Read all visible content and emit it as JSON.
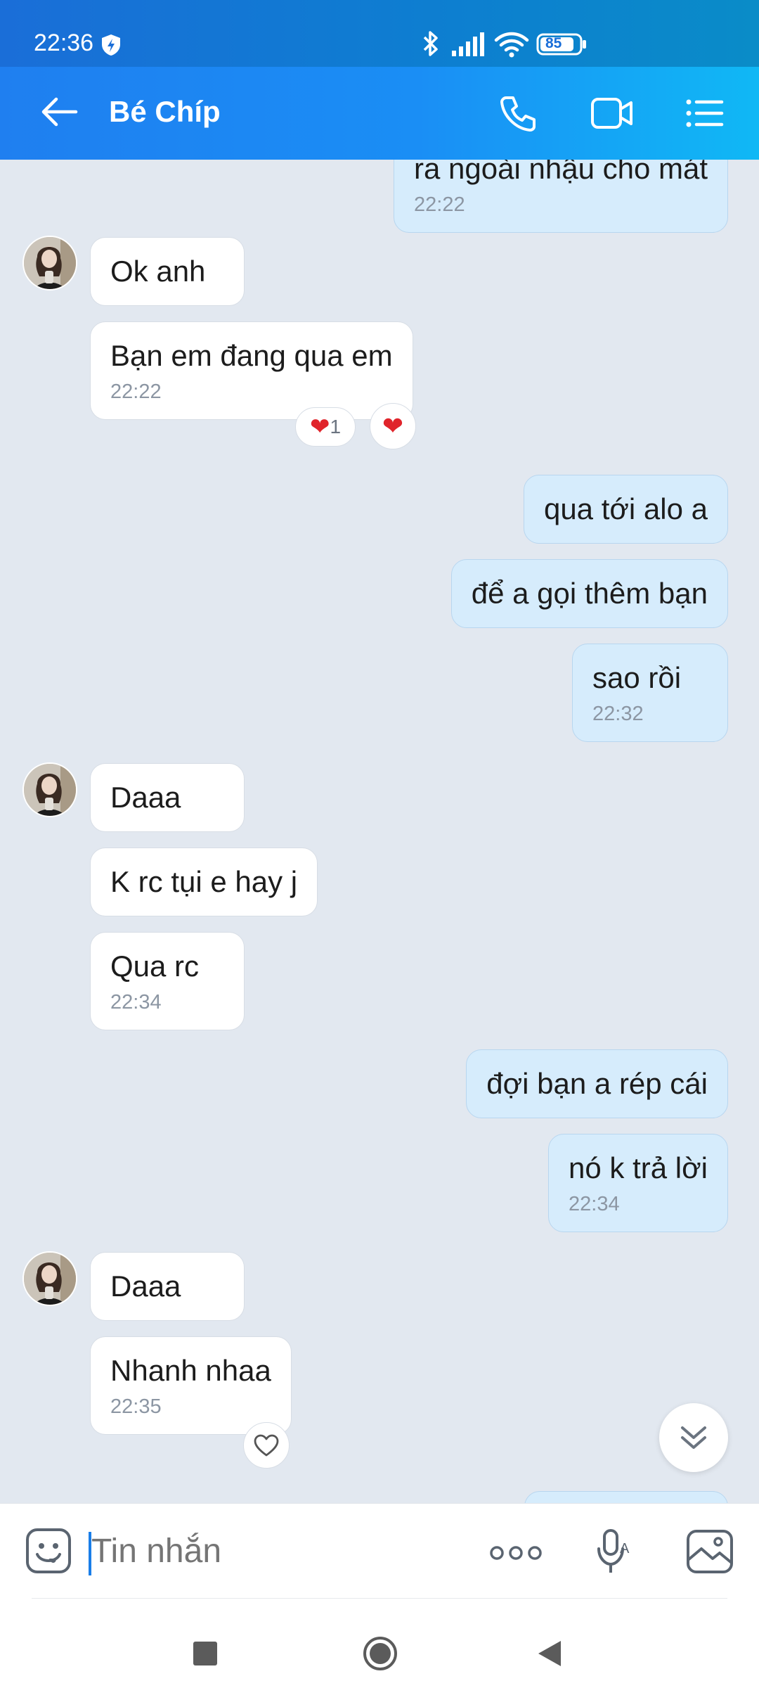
{
  "status_bar": {
    "time": "22:36",
    "battery": "85",
    "icons": [
      "shield-check-icon",
      "bluetooth-icon",
      "signal-icon",
      "wifi-icon",
      "battery-icon"
    ]
  },
  "header": {
    "title": "Bé Chíp",
    "actions": [
      "back-arrow-icon",
      "phone-icon",
      "video-call-icon",
      "list-menu-icon"
    ]
  },
  "messages": [
    {
      "dir": "out",
      "text": "ra ngoài nhậu cho mát",
      "time": "22:22"
    },
    {
      "dir": "in",
      "text": "Ok anh",
      "avatar": true
    },
    {
      "dir": "in",
      "text": "Bạn em đang qua em",
      "time": "22:22",
      "reaction": "❤",
      "reaction_count": "1"
    },
    {
      "dir": "out",
      "text": "qua tới alo a"
    },
    {
      "dir": "out",
      "text": "để a gọi thêm bạn"
    },
    {
      "dir": "out",
      "text": "sao rồi",
      "time": "22:32"
    },
    {
      "dir": "in",
      "text": "Daaa",
      "avatar": true
    },
    {
      "dir": "in",
      "text": "K rc tụi e hay j"
    },
    {
      "dir": "in",
      "text": "Qua rc",
      "time": "22:34"
    },
    {
      "dir": "out",
      "text": "đợi bạn a rép cái"
    },
    {
      "dir": "out",
      "text": "nó k trả lời",
      "time": "22:34"
    },
    {
      "dir": "in",
      "text": "Daaa",
      "avatar": true
    },
    {
      "dir": "in",
      "text": "Nhanh nhaa",
      "time": "22:35"
    }
  ],
  "input": {
    "placeholder": "Tin nhắn"
  },
  "colors": {
    "header_start": "#1f7ff0",
    "header_end": "#10b8f5",
    "chat_background": "#e2e8f0",
    "bubble_out": "#d6ecfc",
    "bubble_in": "#ffffff"
  }
}
